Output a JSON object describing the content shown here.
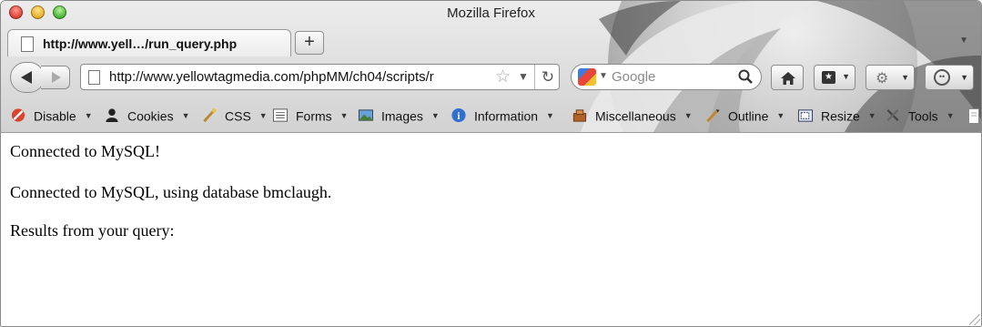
{
  "window": {
    "title": "Mozilla Firefox"
  },
  "tab": {
    "label": "http://www.yell…/run_query.php",
    "new_tab_label": "+"
  },
  "nav": {
    "url": "http://www.yellowtagmedia.com/phpMM/ch04/scripts/r",
    "search_placeholder": "Google"
  },
  "web_developer_toolbar": {
    "items": [
      {
        "label": "Disable",
        "icon": "disable-icon"
      },
      {
        "label": "Cookies",
        "icon": "cookies-icon"
      },
      {
        "label": "CSS",
        "icon": "css-icon"
      },
      {
        "label": "Forms",
        "icon": "forms-icon"
      },
      {
        "label": "Images",
        "icon": "images-icon"
      },
      {
        "label": "Information",
        "icon": "information-icon"
      },
      {
        "label": "Miscellaneous",
        "icon": "miscellaneous-icon"
      },
      {
        "label": "Outline",
        "icon": "outline-icon"
      },
      {
        "label": "Resize",
        "icon": "resize-icon"
      },
      {
        "label": "Tools",
        "icon": "tools-icon"
      }
    ]
  },
  "page": {
    "lines": [
      "Connected to MySQL!",
      "Connected to MySQL, using database bmclaugh.",
      "Results from your query:"
    ]
  },
  "colors": {
    "chrome_top": "#ececec",
    "chrome_bottom": "#d2d2d2",
    "accent_blue": "#2f6fd0"
  }
}
